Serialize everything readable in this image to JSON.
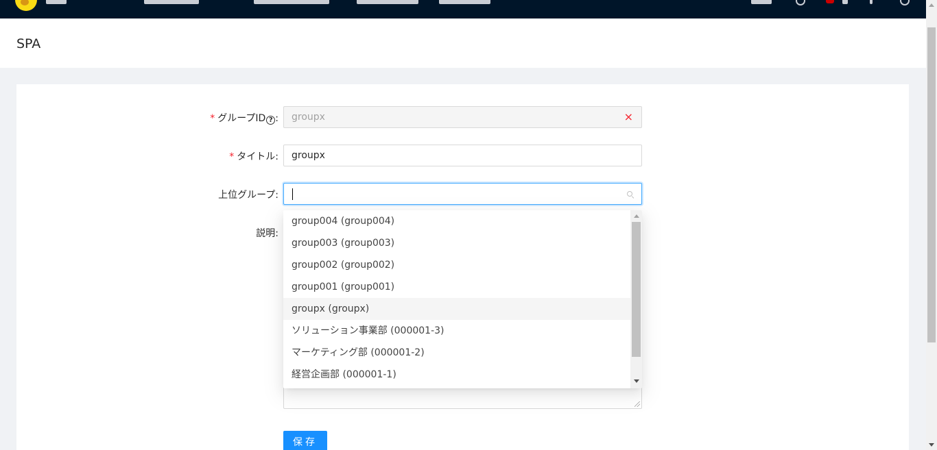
{
  "colors": {
    "nav_bg": "#001529",
    "primary": "#1890ff",
    "required": "#f5222d"
  },
  "page": {
    "title": "SPA"
  },
  "form": {
    "group_id": {
      "label": "グループID",
      "label_suffix": ":",
      "required_mark": "*",
      "help_icon": "?",
      "value": "groupx",
      "clear_icon": "×"
    },
    "title": {
      "label": "タイトル",
      "label_suffix": ":",
      "required_mark": "*",
      "value": "groupx"
    },
    "parent_group": {
      "label": "上位グループ",
      "label_suffix": ":",
      "value": ""
    },
    "description": {
      "label": "説明",
      "label_suffix": ":",
      "value": ""
    },
    "save_label": "保存"
  },
  "dropdown": {
    "options": [
      "group004 (group004)",
      "group003 (group003)",
      "group002 (group002)",
      "group001 (group001)",
      "groupx (groupx)",
      "ソリューション事業部 (000001-3)",
      "マーケティング部 (000001-2)",
      "経営企画部 (000001-1)"
    ],
    "highlighted_option": "groupx (groupx)"
  }
}
